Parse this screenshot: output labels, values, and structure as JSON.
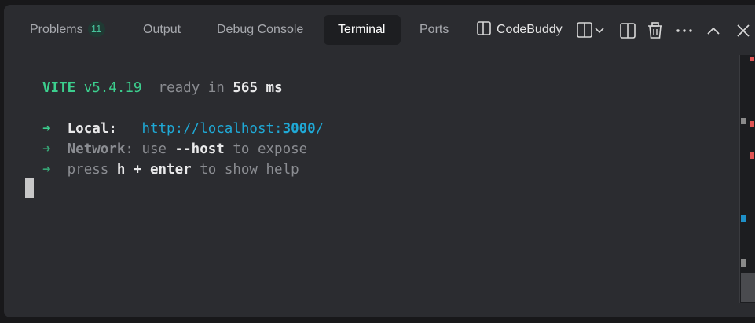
{
  "tabs": {
    "problems": {
      "label": "Problems",
      "badge": "11"
    },
    "output": {
      "label": "Output"
    },
    "debug_console": {
      "label": "Debug Console"
    },
    "terminal": {
      "label": "Terminal"
    },
    "ports": {
      "label": "Ports"
    }
  },
  "toolbar": {
    "codebuddy_label": "CodeBuddy",
    "icons": [
      "panel-layout-icon",
      "chevron-down-icon",
      "split-terminal-icon",
      "trash-icon",
      "more-icon",
      "maximize-panel-icon",
      "close-icon"
    ]
  },
  "terminal": {
    "header": {
      "name": "VITE",
      "version": "v5.4.19",
      "ready_text": "ready in",
      "ms_value": "565",
      "ms_unit": "ms"
    },
    "local": {
      "arrow": "➜",
      "label": "Local:",
      "url_prefix": "http://localhost:",
      "port": "3000",
      "url_suffix": "/"
    },
    "network": {
      "arrow": "➜",
      "label": "Network",
      "text1": ": use ",
      "flag": "--host",
      "text2": " to expose"
    },
    "help": {
      "arrow": "➜",
      "text1": "press ",
      "keys": "h + enter",
      "text2": " to show help"
    }
  },
  "colors": {
    "accent_green": "#3ccf8e",
    "url_blue": "#1fa9d6",
    "panel_bg": "#2b2c30",
    "active_tab_bg": "#1d1e21",
    "marker_red": "#e05555",
    "marker_blue": "#1e90c8"
  }
}
